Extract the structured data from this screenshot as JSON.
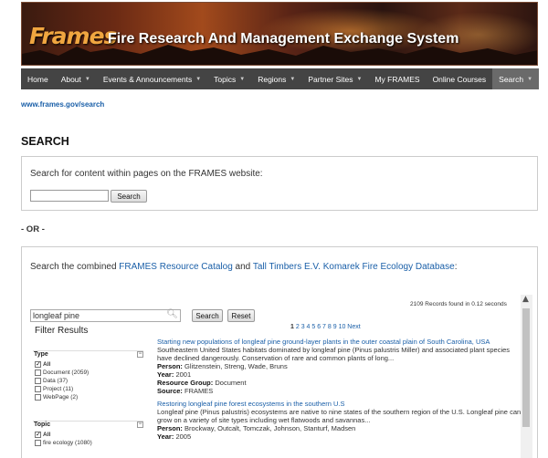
{
  "header": {
    "logo": "Frames",
    "tagline": "Fire Research And Management Exchange System"
  },
  "nav": [
    {
      "label": "Home",
      "caret": false
    },
    {
      "label": "About",
      "caret": true
    },
    {
      "label": "Events & Announcements",
      "caret": true
    },
    {
      "label": "Topics",
      "caret": true
    },
    {
      "label": "Regions",
      "caret": true
    },
    {
      "label": "Partner Sites",
      "caret": true
    },
    {
      "label": "My FRAMES",
      "caret": false
    },
    {
      "label": "Online Courses",
      "caret": false
    },
    {
      "label": "Search",
      "caret": true
    }
  ],
  "breadcrumb": "www.frames.gov/search",
  "page_title": "SEARCH",
  "site_search": {
    "label": "Search for content within pages on the FRAMES website:",
    "input_value": "",
    "button": "Search"
  },
  "or_label": "- OR -",
  "combined": {
    "intro_pre": "Search the combined ",
    "link1": "FRAMES Resource Catalog",
    "intro_mid": " and ",
    "link2": "Tall Timbers E.V. Komarek Fire Ecology Database",
    "intro_post": ":",
    "query": "longleaf pine",
    "search_button": "Search",
    "reset_button": "Reset",
    "records": "2109 Records found in 0.12 seconds",
    "filter_heading": "Filter Results",
    "pager_current": "1",
    "pager_pages": "2 3 4 5 6 7 8 9 10 Next"
  },
  "facets": {
    "type": {
      "title": "Type",
      "options": [
        {
          "label": "All",
          "checked": true,
          "bold": true
        },
        {
          "label": "Document (2059)",
          "checked": false
        },
        {
          "label": "Data (37)",
          "checked": false
        },
        {
          "label": "Project (11)",
          "checked": false
        },
        {
          "label": "WebPage (2)",
          "checked": false
        }
      ]
    },
    "topic": {
      "title": "Topic",
      "options": [
        {
          "label": "All",
          "checked": true,
          "bold": true
        },
        {
          "label": "fire ecology (1080)",
          "checked": false
        }
      ]
    }
  },
  "results": [
    {
      "title": "Starting new populations of longleaf pine ground-layer plants in the outer coastal plain of South Carolina, USA",
      "desc": "Southeastern United States habitats dominated by longleaf pine (Pinus palustris Miller) and associated plant species have declined dangerously. Conservation of rare and common plants of long...",
      "person_label": "Person:",
      "person": "Glitzenstein, Streng, Wade, Bruns",
      "year_label": "Year:",
      "year": "2001",
      "group_label": "Resource Group:",
      "group": "Document",
      "source_label": "Source:",
      "source": "FRAMES"
    },
    {
      "title": "Restoring longleaf pine forest ecosystems in the southern U.S",
      "desc": "Longleaf pine (Pinus palustris) ecosystems are native to nine states of the southern region of the U.S. Longleaf pine can grow on a variety of site types including wet flatwoods and savannas...",
      "person_label": "Person:",
      "person": "Brockway, Outcalt, Tomczak, Johnson, Stanturf, Madsen",
      "year_label": "Year:",
      "year": "2005"
    }
  ]
}
